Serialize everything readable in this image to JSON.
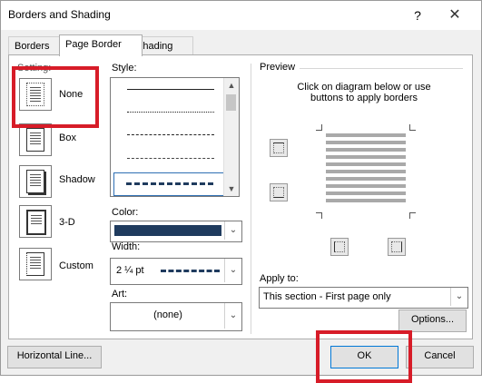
{
  "dialog": {
    "title": "Borders and Shading",
    "help": "?",
    "close": "✕"
  },
  "tabs": [
    {
      "label": "Borders",
      "active": false
    },
    {
      "label": "Page Border",
      "active": true
    },
    {
      "label": "Shading",
      "active": false
    }
  ],
  "setting": {
    "label": "Setting:",
    "items": [
      {
        "label": "None",
        "selected": true
      },
      {
        "label": "Box",
        "selected": false
      },
      {
        "label": "Shadow",
        "selected": false
      },
      {
        "label": "3-D",
        "selected": false
      },
      {
        "label": "Custom",
        "selected": false
      }
    ]
  },
  "style": {
    "label": "Style:"
  },
  "color": {
    "label": "Color:",
    "value_hex": "#1f3b5e"
  },
  "width": {
    "label": "Width:",
    "value": "2 ¼ pt"
  },
  "art": {
    "label": "Art:",
    "value": "(none)"
  },
  "preview": {
    "label": "Preview",
    "instruction_line1": "Click on diagram below or use",
    "instruction_line2": "buttons to apply borders"
  },
  "apply_to": {
    "label": "Apply to:",
    "value": "This section - First page only"
  },
  "buttons": {
    "options": "Options...",
    "horizontal_line": "Horizontal Line...",
    "ok": "OK",
    "cancel": "Cancel"
  },
  "highlight_color": "#d71c28"
}
